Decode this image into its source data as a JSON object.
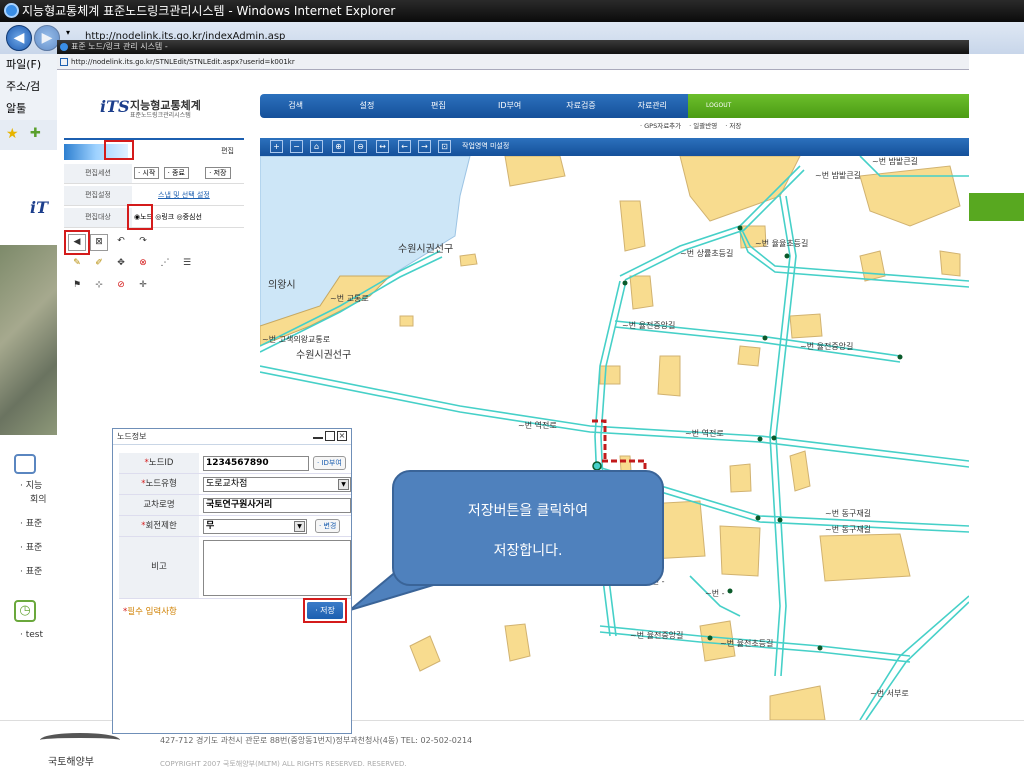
{
  "outer": {
    "title": "지능형교통체계 표준노드링크관리시스템 - Windows Internet Explorer",
    "address": "http://nodelink.its.go.kr/indexAdmin.asp",
    "menu_file": "파일(F)",
    "address_label": "주소/검",
    "side_label": "알툴",
    "footer_address": "427-712 경기도 과천시 관문로 88번(중앙동1번지)정부과천청사(4동)  TEL: 02-502-0214",
    "footer_copyright": "COPYRIGHT 2007 국토해양부(MLTM) ALL RIGHTS RESERVED. RESERVED.",
    "footer_logo": "국토해양부",
    "bottom_items": [
      "지능",
      "회의",
      "표준",
      "표준",
      "표준"
    ],
    "test_item": "test"
  },
  "inner": {
    "title": "표준 노드/링크 관리 시스템 -",
    "address": "http://nodelink.its.go.kr/STNLEdit/STNLEdit.aspx?userid=k001kr"
  },
  "logo": {
    "mark": "iTS",
    "title": "지능형교통체계",
    "subtitle": "표준노드링크관리시스템"
  },
  "topnav": {
    "items": [
      "검색",
      "설정",
      "편집",
      "ID부여",
      "자료검증",
      "자료관리"
    ],
    "logout": "LOGOUT"
  },
  "subnav": [
    "· GPS자료추가",
    "· 일괄반영",
    "· 저장"
  ],
  "edit_panel": {
    "header": "편집",
    "rows": [
      {
        "key": "편집세션",
        "chips": [
          "· 시작",
          "· 종료",
          "· 저장"
        ]
      },
      {
        "key": "편집설정",
        "link": "스냅 및 선택 설정"
      },
      {
        "key": "편집대상",
        "radios": [
          "노드",
          "링크",
          "중심선"
        ],
        "selected": "노드"
      }
    ]
  },
  "map_toolbar": {
    "status": "작업영역 미설정"
  },
  "map_labels": {
    "city": "의왕시",
    "district1": "수원시권선구",
    "district2": "수원시권선구",
    "road1": "~번 역전로",
    "road2": "~번 역전로",
    "road3": "~번 동구재길",
    "road4": "~번 동구재길",
    "road5": "~번 율전중앙길",
    "road6": "~번 율전중앙길",
    "road7": "~번 율전중앙길",
    "road8": "~번 율전초등길",
    "road9": "~번 밤밭큰길",
    "road10": "~번 밤밭큰길",
    "road11": "~번 서부로",
    "road12": "~번 -",
    "road13": "~번 -",
    "road14": "~번 상률초등길",
    "road15": "~번 율율초등길",
    "road16": "~번 고색의왕교통로",
    "road17": "~번 교통로"
  },
  "dialog": {
    "title": "노드정보",
    "fields": {
      "node_id": {
        "label": "노드ID",
        "value": "1234567890",
        "button": "· ID부여"
      },
      "node_type": {
        "label": "노드유형",
        "value": "도로교차점"
      },
      "intersection": {
        "label": "교차로명",
        "value": "국토연구원사거리"
      },
      "turn": {
        "label": "회전제한",
        "value": "무",
        "button": "· 변경"
      },
      "note": {
        "label": "비고",
        "value": ""
      }
    },
    "required_note": "필수 입력사항",
    "save_button": "· 저장"
  },
  "callout": {
    "line1": "저장버튼을 클릭하여",
    "line2": "저장합니다."
  },
  "colors": {
    "road": "#46d0c8",
    "block": "#f8dc8f",
    "water": "#cde6f7",
    "accent": "#1c5fb0",
    "highlight": "#d41b1b",
    "callout": "#4f81bd"
  }
}
